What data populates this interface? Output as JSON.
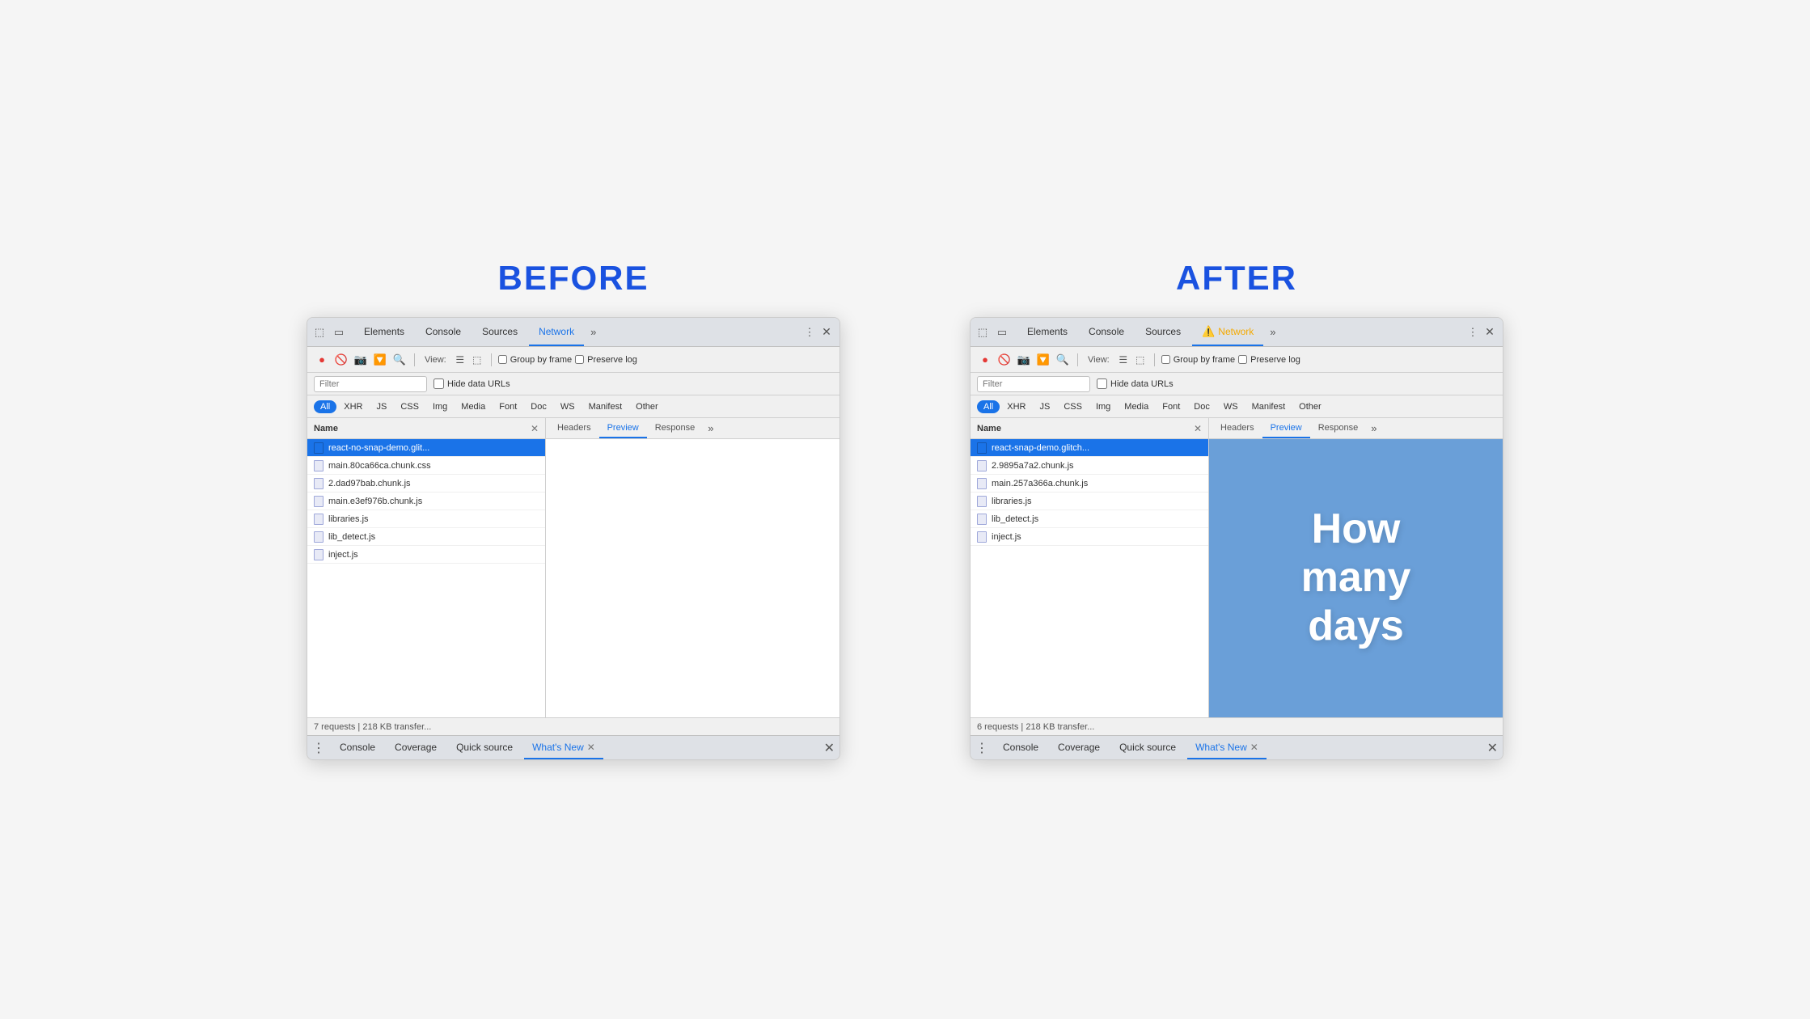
{
  "before_label": "BEFORE",
  "after_label": "AFTER",
  "devtools": {
    "tabs": [
      "Elements",
      "Console",
      "Sources"
    ],
    "active_tab_before": "Network",
    "active_tab_after": "Network",
    "more": "»",
    "close": "✕",
    "toolbar": {
      "view_label": "View:",
      "group_by_frame": "Group by frame",
      "preserve_log": "Preserve log"
    },
    "filter_placeholder": "Filter",
    "hide_data_urls": "Hide data URLs",
    "type_filters": [
      "All",
      "XHR",
      "JS",
      "CSS",
      "Img",
      "Media",
      "Font",
      "Doc",
      "WS",
      "Manifest",
      "Other"
    ],
    "col_name": "Name",
    "detail_tabs": [
      "Headers",
      "Preview",
      "Response"
    ],
    "detail_more": "»",
    "before": {
      "files": [
        "react-no-snap-demo.glit...",
        "main.80ca66ca.chunk.css",
        "2.dad97bab.chunk.js",
        "main.e3ef976b.chunk.js",
        "libraries.js",
        "lib_detect.js",
        "inject.js"
      ],
      "active_file": "react-no-snap-demo.glit...",
      "active_detail_tab": "Preview",
      "status": "7 requests | 218 KB transfer...",
      "preview": "blank"
    },
    "after": {
      "files": [
        "react-snap-demo.glitch...",
        "2.9895a7a2.chunk.js",
        "main.257a366a.chunk.js",
        "libraries.js",
        "lib_detect.js",
        "inject.js"
      ],
      "active_file": "react-snap-demo.glitch...",
      "active_detail_tab": "Preview",
      "status": "6 requests | 218 KB transfer...",
      "preview": "image",
      "preview_text": "How\nmany\ndays"
    },
    "bottom_tabs": [
      "Console",
      "Coverage",
      "Quick source",
      "What's New"
    ],
    "active_bottom_tab": "What's New"
  }
}
